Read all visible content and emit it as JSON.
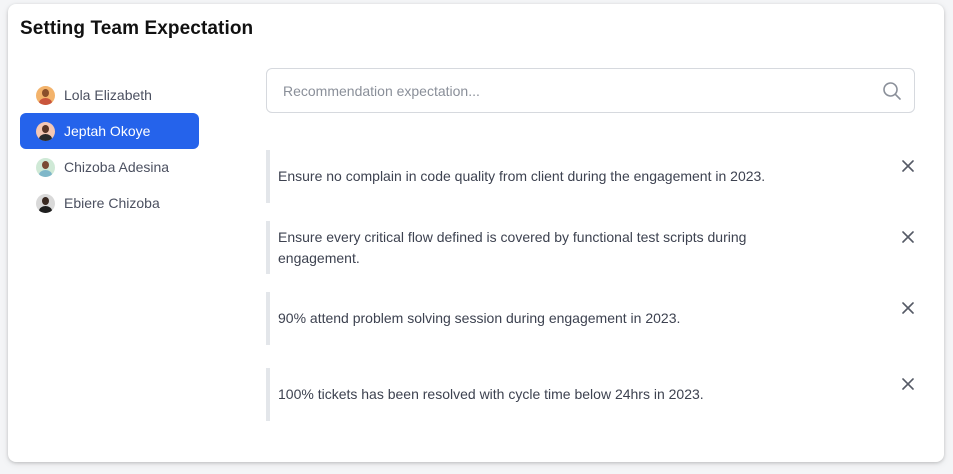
{
  "header": {
    "title": "Setting Team Expectation"
  },
  "sidebar": {
    "members": [
      {
        "name": "Lola Elizabeth",
        "active": false,
        "avatar": {
          "bg": "#f3b36b",
          "skin": "#8a4f2a",
          "shirt": "#c9553c"
        }
      },
      {
        "name": "Jeptah Okoye",
        "active": true,
        "avatar": {
          "bg": "#f5c8b4",
          "skin": "#5a3525",
          "shirt": "#2b2b2b"
        }
      },
      {
        "name": "Chizoba Adesina",
        "active": false,
        "avatar": {
          "bg": "#cfe9d6",
          "skin": "#7a4a33",
          "shirt": "#7fb7c9"
        }
      },
      {
        "name": "Ebiere Chizoba",
        "active": false,
        "avatar": {
          "bg": "#d9d9d9",
          "skin": "#3a2a22",
          "shirt": "#1f1f1f"
        }
      }
    ]
  },
  "search": {
    "placeholder": "Recommendation expectation...",
    "value": "",
    "icon": "search-icon"
  },
  "expectations": [
    {
      "text": "Ensure no complain in code quality from client during the engagement in 2023."
    },
    {
      "text": "Ensure every critical flow defined is covered by functional test scripts during engagement."
    },
    {
      "text": "90% attend problem solving session during engagement in 2023."
    },
    {
      "text": "100% tickets has been resolved with cycle time below 24hrs in 2023."
    }
  ],
  "colors": {
    "accent": "#2563eb",
    "divider": "#e3e6ea"
  }
}
